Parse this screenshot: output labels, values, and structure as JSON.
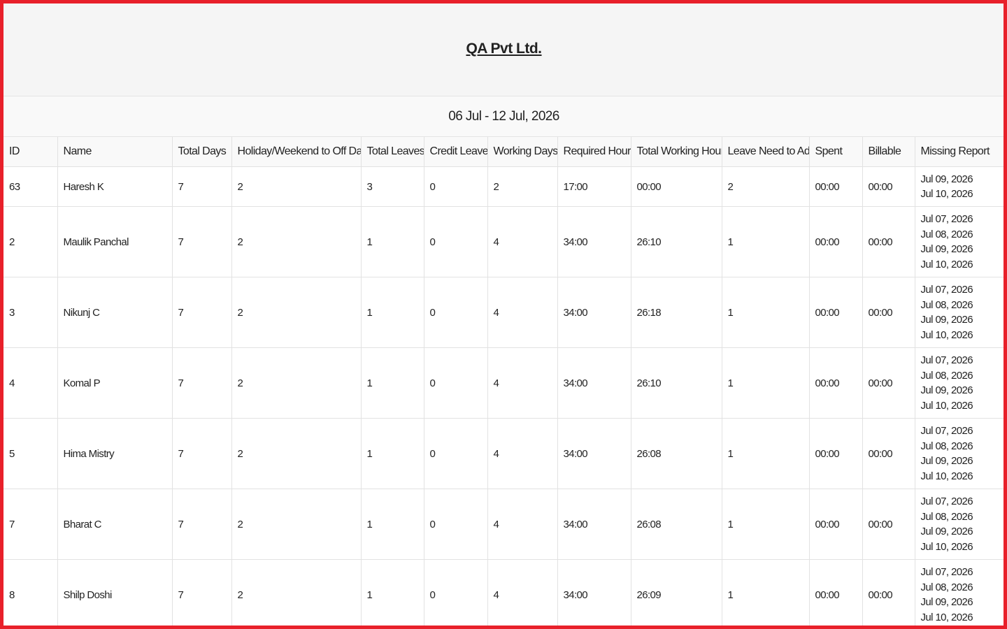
{
  "report": {
    "company": "QA Pvt Ltd.",
    "date_range": "06 Jul - 12 Jul, 2026"
  },
  "table": {
    "headers": [
      "ID",
      "Name",
      "Total Days",
      "Holiday/Weekend to Off Days",
      "Total Leaves",
      "Credit Leave",
      "Working Days",
      "Required Hours",
      "Total Working Hours",
      "Leave Need to Add",
      "Spent",
      "Billable",
      "Missing Report"
    ],
    "rows": [
      {
        "id": "63",
        "name": "Haresh K",
        "total_days": "7",
        "holiday_off": "2",
        "total_leaves": "3",
        "credit_leave": "0",
        "working_days": "2",
        "required_hours": "17:00",
        "total_working_hours": "00:00",
        "leave_need_to_add": "2",
        "spent": "00:00",
        "billable": "00:00",
        "missing_report": [
          "Jul 09, 2026",
          "Jul 10, 2026"
        ]
      },
      {
        "id": "2",
        "name": "Maulik Panchal",
        "total_days": "7",
        "holiday_off": "2",
        "total_leaves": "1",
        "credit_leave": "0",
        "working_days": "4",
        "required_hours": "34:00",
        "total_working_hours": "26:10",
        "leave_need_to_add": "1",
        "spent": "00:00",
        "billable": "00:00",
        "missing_report": [
          "Jul 07, 2026",
          "Jul 08, 2026",
          "Jul 09, 2026",
          "Jul 10, 2026"
        ]
      },
      {
        "id": "3",
        "name": "Nikunj C",
        "total_days": "7",
        "holiday_off": "2",
        "total_leaves": "1",
        "credit_leave": "0",
        "working_days": "4",
        "required_hours": "34:00",
        "total_working_hours": "26:18",
        "leave_need_to_add": "1",
        "spent": "00:00",
        "billable": "00:00",
        "missing_report": [
          "Jul 07, 2026",
          "Jul 08, 2026",
          "Jul 09, 2026",
          "Jul 10, 2026"
        ]
      },
      {
        "id": "4",
        "name": "Komal P",
        "total_days": "7",
        "holiday_off": "2",
        "total_leaves": "1",
        "credit_leave": "0",
        "working_days": "4",
        "required_hours": "34:00",
        "total_working_hours": "26:10",
        "leave_need_to_add": "1",
        "spent": "00:00",
        "billable": "00:00",
        "missing_report": [
          "Jul 07, 2026",
          "Jul 08, 2026",
          "Jul 09, 2026",
          "Jul 10, 2026"
        ]
      },
      {
        "id": "5",
        "name": "Hima Mistry",
        "total_days": "7",
        "holiday_off": "2",
        "total_leaves": "1",
        "credit_leave": "0",
        "working_days": "4",
        "required_hours": "34:00",
        "total_working_hours": "26:08",
        "leave_need_to_add": "1",
        "spent": "00:00",
        "billable": "00:00",
        "missing_report": [
          "Jul 07, 2026",
          "Jul 08, 2026",
          "Jul 09, 2026",
          "Jul 10, 2026"
        ]
      },
      {
        "id": "7",
        "name": "Bharat C",
        "total_days": "7",
        "holiday_off": "2",
        "total_leaves": "1",
        "credit_leave": "0",
        "working_days": "4",
        "required_hours": "34:00",
        "total_working_hours": "26:08",
        "leave_need_to_add": "1",
        "spent": "00:00",
        "billable": "00:00",
        "missing_report": [
          "Jul 07, 2026",
          "Jul 08, 2026",
          "Jul 09, 2026",
          "Jul 10, 2026"
        ]
      },
      {
        "id": "8",
        "name": "Shilp Doshi",
        "total_days": "7",
        "holiday_off": "2",
        "total_leaves": "1",
        "credit_leave": "0",
        "working_days": "4",
        "required_hours": "34:00",
        "total_working_hours": "26:09",
        "leave_need_to_add": "1",
        "spent": "00:00",
        "billable": "00:00",
        "missing_report": [
          "Jul 07, 2026",
          "Jul 08, 2026",
          "Jul 09, 2026",
          "Jul 10, 2026"
        ]
      }
    ]
  },
  "colors": {
    "frame_border": "#e8202a",
    "header_bg": "#f5f5f5",
    "grid_line": "#e2e2e2"
  }
}
